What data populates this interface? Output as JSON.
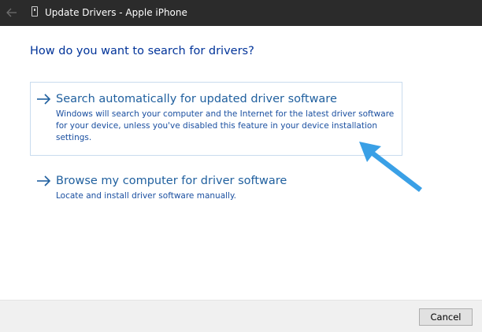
{
  "window": {
    "title": "Update Drivers - Apple iPhone"
  },
  "icons": {
    "back": "back-arrow-icon",
    "device": "phone-device-icon",
    "option_arrow": "right-arrow-icon",
    "pointer": "annotation-pointer-arrow"
  },
  "colors": {
    "titlebar": "#2b2b2b",
    "heading": "#003399",
    "link": "#1f5f9e",
    "annotation": "#3aa0e6"
  },
  "main": {
    "heading": "How do you want to search for drivers?",
    "options": [
      {
        "title": "Search automatically for updated driver software",
        "description": "Windows will search your computer and the Internet for the latest driver software for your device, unless you've disabled this feature in your device installation settings.",
        "selected": true
      },
      {
        "title": "Browse my computer for driver software",
        "description": "Locate and install driver software manually.",
        "selected": false
      }
    ]
  },
  "footer": {
    "cancel_label": "Cancel"
  }
}
